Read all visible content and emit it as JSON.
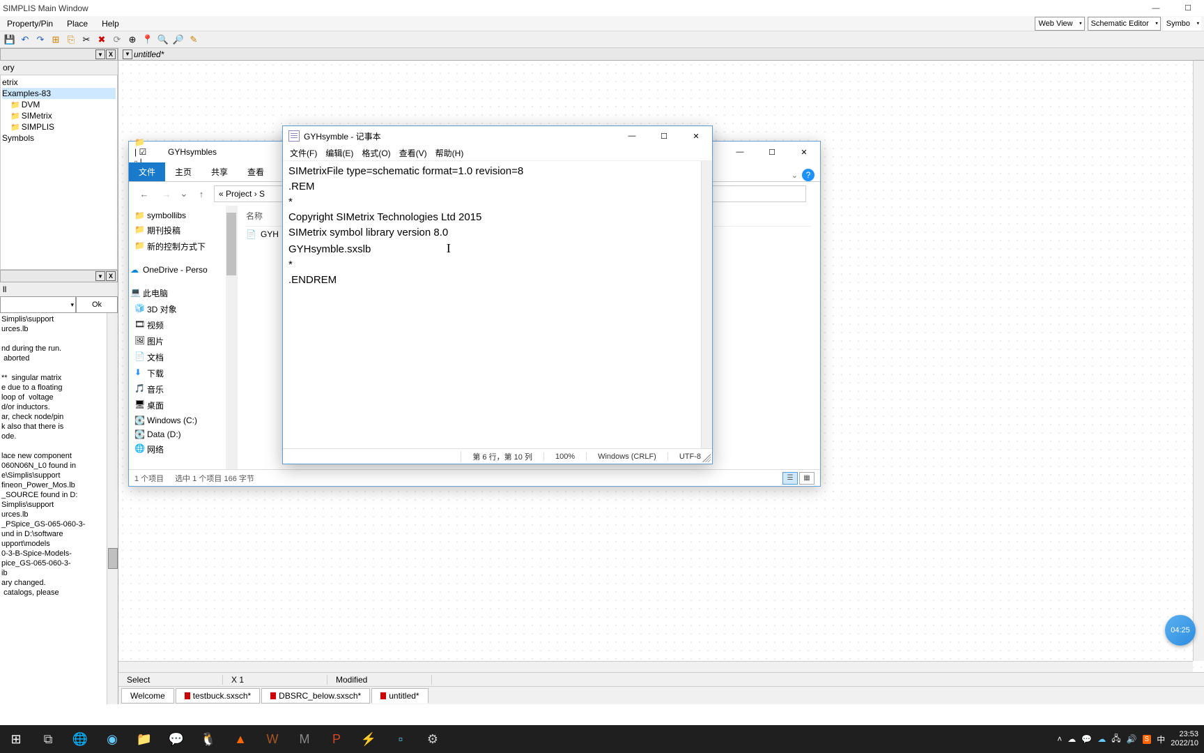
{
  "app": {
    "title": "SIMPLIS Main Window",
    "menus": [
      "Property/Pin",
      "Place",
      "Help"
    ],
    "modes": {
      "view": "Web View",
      "editor": "Schematic Editor",
      "type": "Symbo"
    }
  },
  "left_panel": {
    "top_title": "ory",
    "tree": [
      "etrix",
      "Examples-83",
      "DVM",
      "SIMetrix",
      "SIMPLIS",
      "Symbols"
    ],
    "mid_title": "ll",
    "ok": "Ok",
    "log": "Simplis\\support\nurces.lb\n\nnd during the run.\n aborted\n\n**  singular matrix\ne due to a floating\nloop of  voltage\nd/or inductors.\nar, check node/pin\nk also that there is\node.\n\nlace new component\n060N06N_L0 found in\ne\\Simplis\\support\nfineon_Power_Mos.lb\n_SOURCE found in D:\nSimplis\\support\nurces.lb\n_PSpice_GS-065-060-3-\nund in D:\\software\nupport\\models\n0-3-B-Spice-Models-\npice_GS-065-060-3-\nib\nary changed.\n catalogs, please"
  },
  "doc": {
    "title": "untitled*",
    "status": {
      "mode": "Select",
      "scale": "X 1",
      "modified": "Modified"
    },
    "tabs": [
      "Welcome",
      "testbuck.sxsch*",
      "DBSRC_below.sxsch*",
      "untitled*"
    ],
    "float_badge": "04:25"
  },
  "explorer": {
    "title_path": "GYHsymbles",
    "ribbon_tabs": [
      "文件",
      "主页",
      "共享",
      "查看"
    ],
    "breadcrumb": "«  Project  ›  S",
    "search_placeholder": "",
    "nav_items": [
      {
        "icon": "📁",
        "label": "symbollibs"
      },
      {
        "icon": "📁",
        "label": "期刊投稿"
      },
      {
        "icon": "📁",
        "label": "新的控制方式下"
      },
      {
        "icon": "☁",
        "label": "OneDrive - Perso",
        "spacer_before": true
      },
      {
        "icon": "💻",
        "label": "此电脑",
        "spacer_before": true
      },
      {
        "icon": "🧊",
        "label": "3D 对象"
      },
      {
        "icon": "🎞",
        "label": "视频"
      },
      {
        "icon": "🖼",
        "label": "图片"
      },
      {
        "icon": "📄",
        "label": "文档"
      },
      {
        "icon": "⬇",
        "label": "下载"
      },
      {
        "icon": "🎵",
        "label": "音乐"
      },
      {
        "icon": "🖥",
        "label": "桌面"
      },
      {
        "icon": "💽",
        "label": "Windows (C:)"
      },
      {
        "icon": "💽",
        "label": "Data (D:)"
      },
      {
        "icon": "🌐",
        "label": "网络"
      }
    ],
    "col_header": "名称",
    "file": "GYH",
    "status": {
      "count": "1 个项目",
      "sel": "选中 1 个项目  166 字节"
    }
  },
  "notepad": {
    "title": "GYHsymble - 记事本",
    "menus": [
      "文件(F)",
      "编辑(E)",
      "格式(O)",
      "查看(V)",
      "帮助(H)"
    ],
    "content_lines": [
      "SIMetrixFile type=schematic format=1.0 revision=8",
      ".REM",
      "*",
      "Copyright SIMetrix Technologies Ltd 2015",
      "SIMetrix symbol library version 8.0",
      "GYHsymble.sxslb",
      "*",
      ".ENDREM"
    ],
    "status": {
      "pos": "第 6 行，第 10 列",
      "zoom": "100%",
      "eol": "Windows (CRLF)",
      "enc": "UTF-8"
    }
  },
  "taskbar": {
    "time": "23:53",
    "date": "2022/10"
  }
}
